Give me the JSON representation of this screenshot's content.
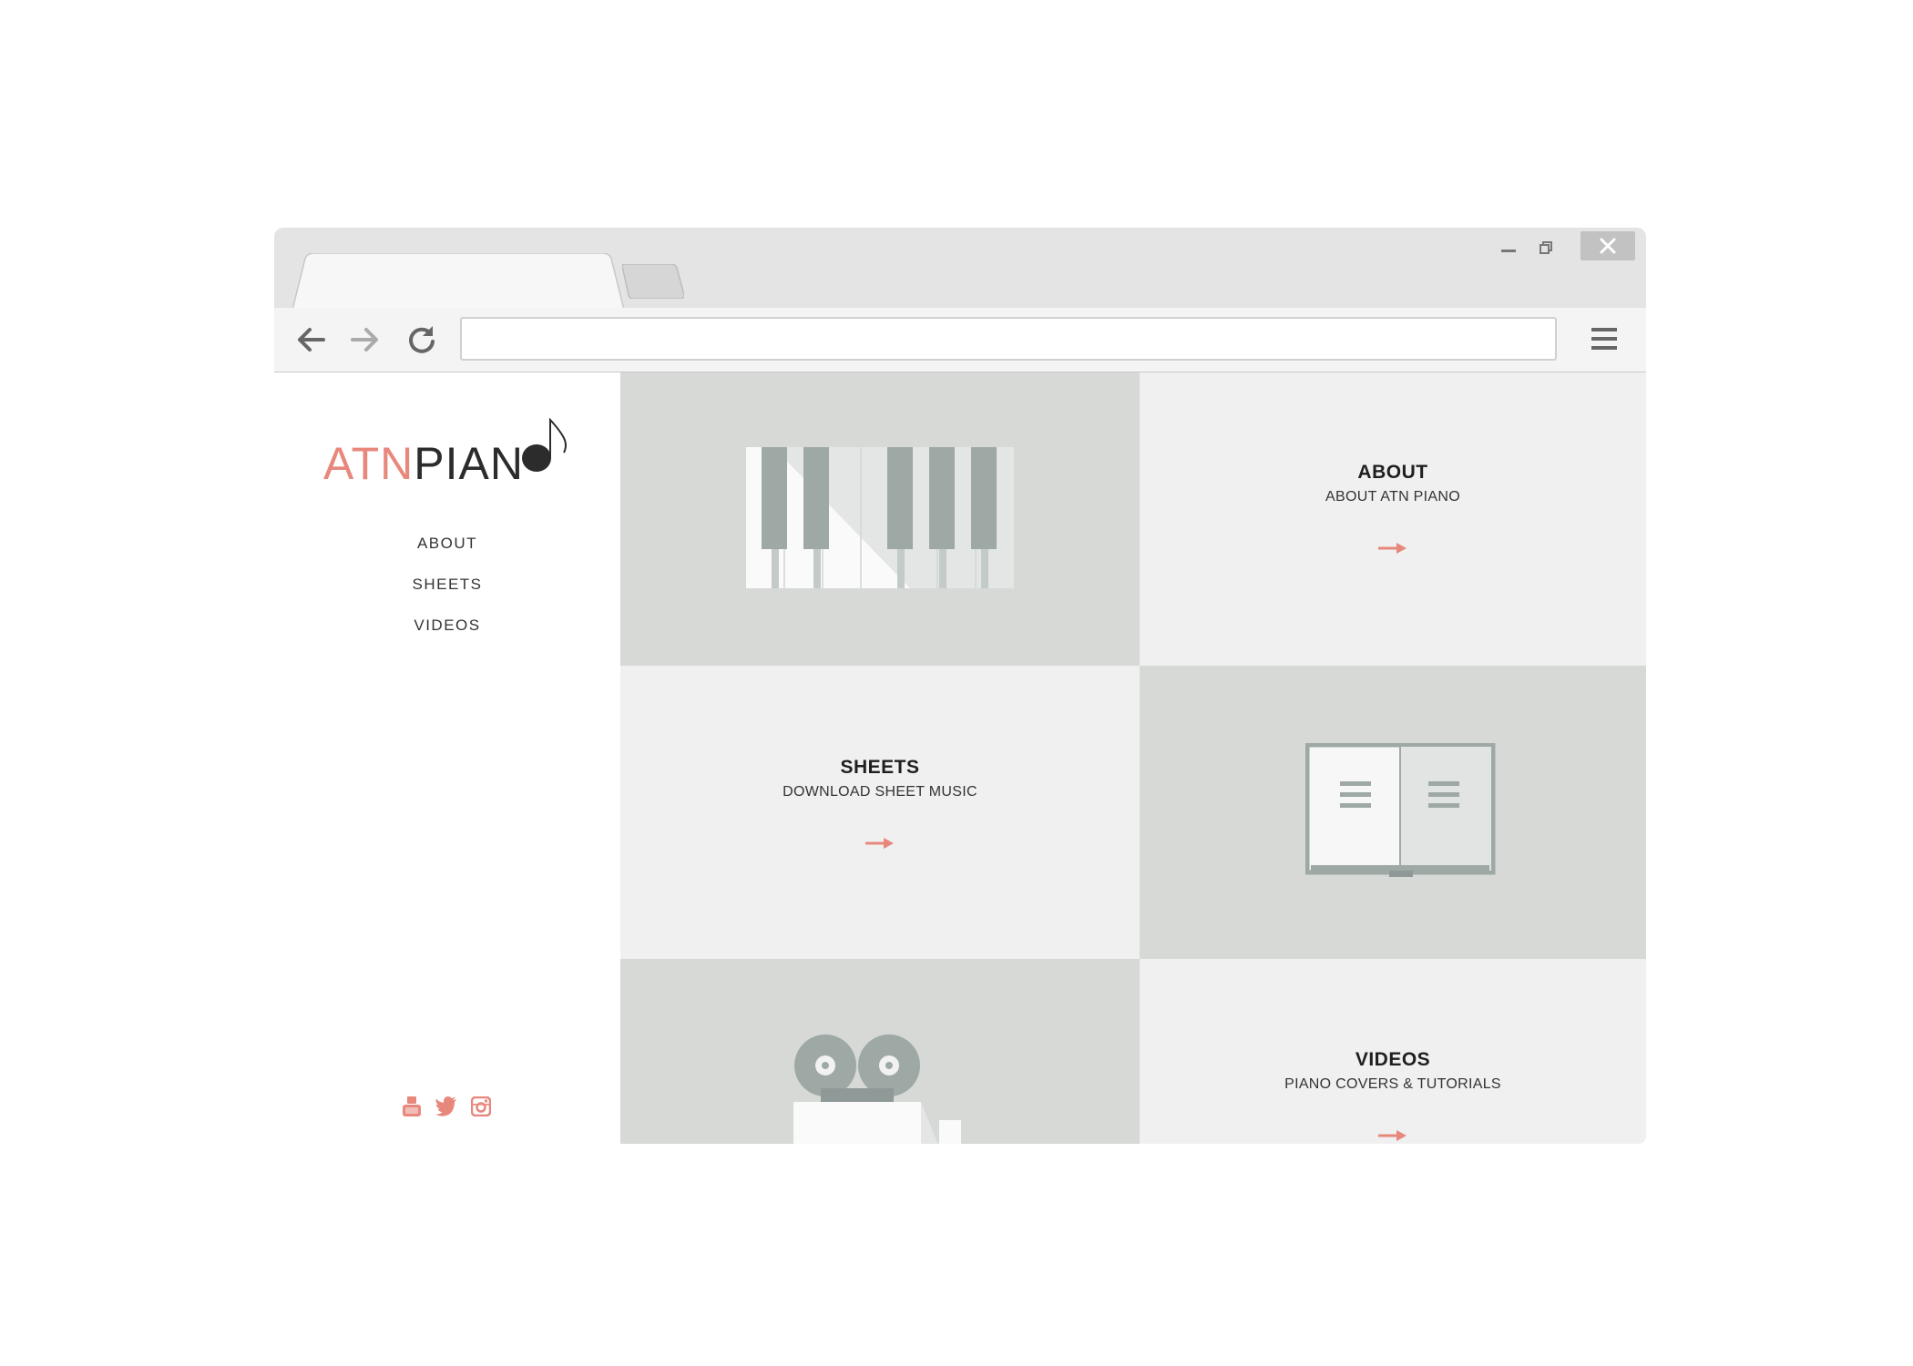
{
  "browser": {
    "window_controls": {
      "minimize_icon": "minimize-icon",
      "restore_icon": "restore-icon",
      "close_icon": "close-icon"
    },
    "toolbar": {
      "back_icon": "back-arrow-icon",
      "forward_icon": "forward-arrow-icon",
      "reload_icon": "reload-icon",
      "menu_icon": "hamburger-menu-icon",
      "address_value": ""
    }
  },
  "site": {
    "logo": {
      "part1": "ATN",
      "part2": "PIAN"
    },
    "nav": [
      {
        "label": "ABOUT"
      },
      {
        "label": "SHEETS"
      },
      {
        "label": "VIDEOS"
      }
    ],
    "social": [
      {
        "icon": "youtube-icon"
      },
      {
        "icon": "twitter-icon"
      },
      {
        "icon": "instagram-icon"
      }
    ],
    "cards": {
      "about": {
        "title": "ABOUT",
        "subtitle": "ABOUT ATN PIANO"
      },
      "sheets": {
        "title": "SHEETS",
        "subtitle": "DOWNLOAD SHEET MUSIC"
      },
      "videos": {
        "title": "VIDEOS",
        "subtitle": "PIANO COVERS & TUTORIALS"
      }
    }
  },
  "colors": {
    "accent": "#e8877c",
    "tile_dark": "#d7d9d6",
    "tile_light": "#f0f0f0",
    "illustration_gray": "#9ea9a6"
  }
}
